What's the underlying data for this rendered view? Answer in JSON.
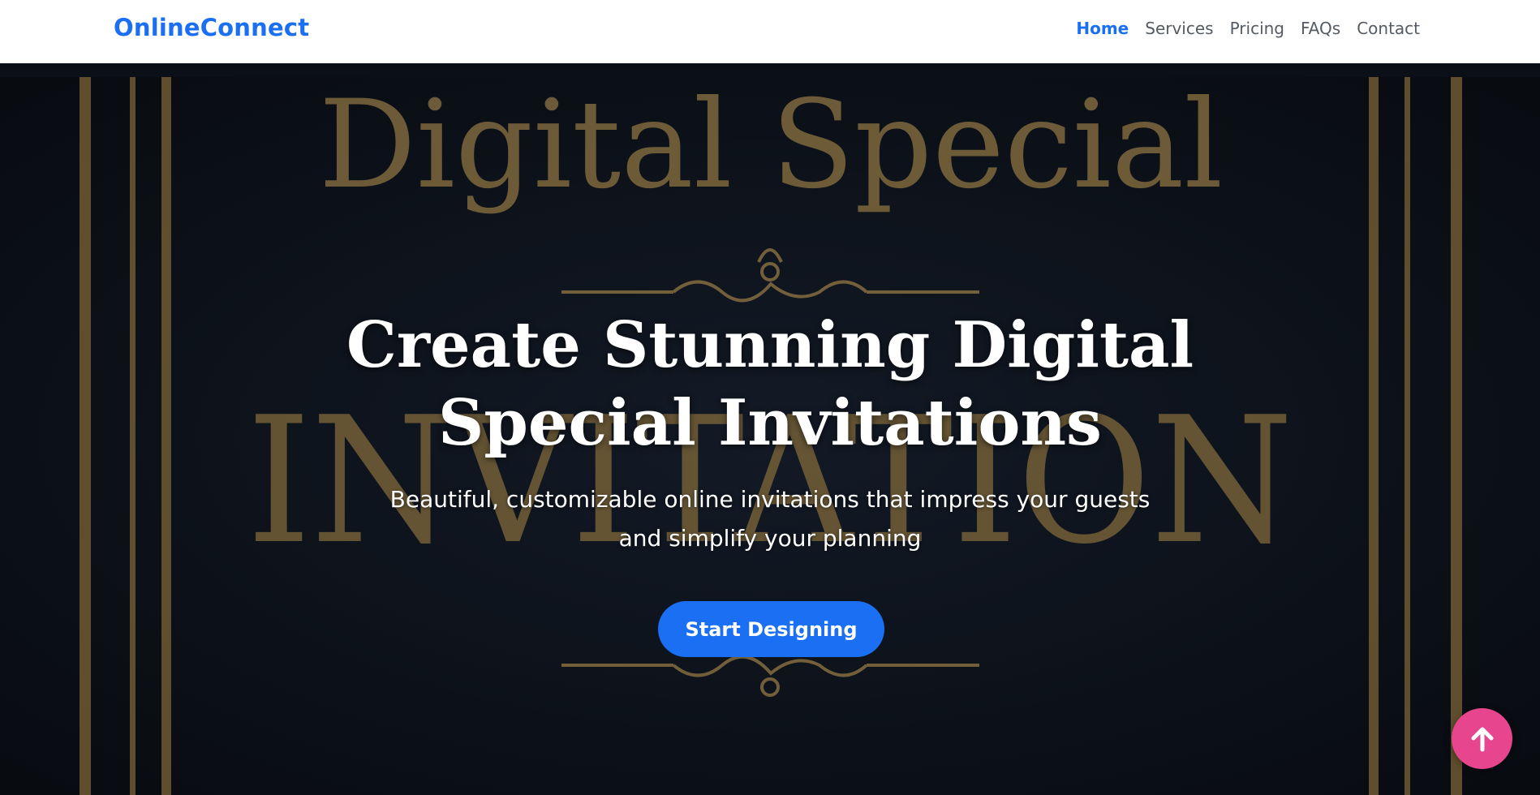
{
  "brand": {
    "name": "OnlineConnect",
    "color": "#1a6ff2"
  },
  "nav": {
    "items": [
      {
        "label": "Home",
        "active": true
      },
      {
        "label": "Services",
        "active": false
      },
      {
        "label": "Pricing",
        "active": false
      },
      {
        "label": "FAQs",
        "active": false
      },
      {
        "label": "Contact",
        "active": false
      }
    ]
  },
  "hero": {
    "background_text_top": "Digital Special",
    "background_text_main": "INVITATION",
    "title_line1": "Create Stunning Digital",
    "title_line2": "Special Invitations",
    "subtitle_line1": "Beautiful, customizable online invitations that impress your guests",
    "subtitle_line2": "and simplify your planning",
    "cta_label": "Start Designing"
  },
  "scroll_top": {
    "icon": "arrow-up-icon",
    "color": "#e8458f"
  },
  "colors": {
    "gold": "#8a7040",
    "accent": "#1a6ff2"
  }
}
